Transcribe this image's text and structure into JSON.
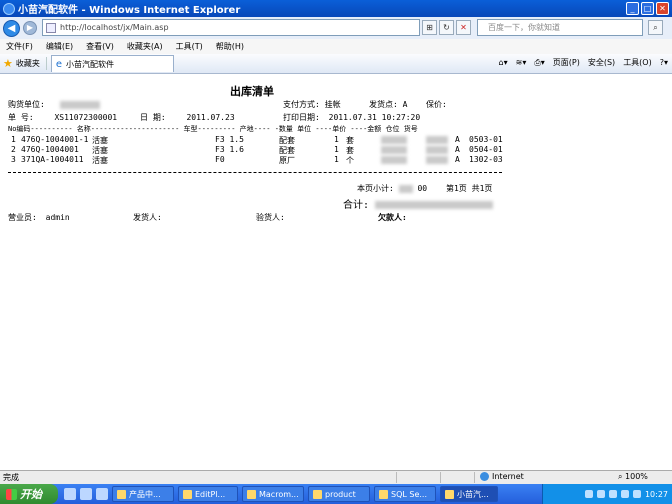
{
  "window": {
    "title": "小苗汽配软件 - Windows Internet Explorer"
  },
  "address": {
    "url": "http://localhost/jx/Main.asp"
  },
  "search": {
    "placeholder": "百度一下，你就知道"
  },
  "menu": [
    "文件(F)",
    "编辑(E)",
    "查看(V)",
    "收藏夹(A)",
    "工具(T)",
    "帮助(H)"
  ],
  "favbar": {
    "favorites_label": "收藏夹",
    "tab_title": "小苗汽配软件"
  },
  "toolbar": {
    "page_label": "页面(P)",
    "safety_label": "安全(S)",
    "tools_label": "工具(O)"
  },
  "doc": {
    "title": "出库清单",
    "buyer_label": "购货单位:",
    "pay_label": "支付方式:",
    "pay_value": "挂帐",
    "ship_label": "发货点:",
    "ship_value": "A",
    "keeper_label": "保价:",
    "no_label": "单 号:",
    "no_value": "XS11072300001",
    "date_label": "日 期:",
    "date_value": "2011.07.23",
    "print_label": "打印日期:",
    "print_value": "2011.07.31 10:27:20",
    "header": "No编码----------    名称---------------------        车型---------   产地----  -数量 单位   ----单价     ----金额 仓位   货号",
    "rows": [
      {
        "no": "1",
        "code": "476Q-1004001-1",
        "name": "活塞",
        "model": "F3 1.5",
        "origin": "配套",
        "qty": "1",
        "unit": "套",
        "loc": "A",
        "item": "0503-01"
      },
      {
        "no": "2",
        "code": "476Q-1004001",
        "name": "活塞",
        "model": "F3 1.6",
        "origin": "配套",
        "qty": "1",
        "unit": "套",
        "loc": "A",
        "item": "0504-01"
      },
      {
        "no": "3",
        "code": "371QA-1004011",
        "name": "活塞",
        "model": "F0",
        "origin": "原厂",
        "qty": "1",
        "unit": "个",
        "loc": "A",
        "item": "1302-03"
      }
    ],
    "subtotal_label": "本页小计:",
    "subtotal_suffix": "00",
    "page_label": "第1页 共1页",
    "total_label": "合计:",
    "clerk_label": "营业员:",
    "clerk_value": "admin",
    "shipper_label": "发货人:",
    "checker_label": "验货人:",
    "owed_label": "欠款人:"
  },
  "status": {
    "done": "完成",
    "zone": "Internet",
    "zoom": "100%"
  },
  "taskbar": {
    "start": "开始",
    "buttons": [
      "产品中...",
      "EditPl...",
      "Macrom...",
      "product",
      "SQL Se...",
      "小苗汽..."
    ],
    "clock": "10:27"
  }
}
